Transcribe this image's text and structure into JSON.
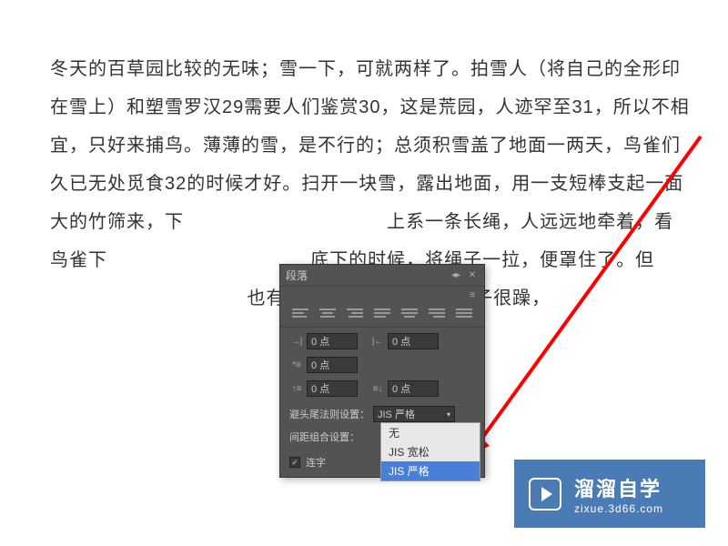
{
  "body_text": "冬天的百草园比较的无味；雪一下，可就两样了。拍雪人（将自己的全形印在雪上）和塑雪罗汉29需要人们鉴赏30，这是荒园，人迹罕至31，所以不相宜，只好来捕鸟。薄薄的雪，是不行的；总须积雪盖了地面一两天，鸟雀们久已无处觅食32的时候才好。扫开一块雪，露出地面，用一支短棒支起一面大的竹筛来，下 　　　　　　　　　　 上系一条长绳，人远远地牵着，看鸟雀下 　　　　　　　　　　 底下的时候，将绳子一拉，便罩住了。但 　　　　　　　　　　 也有白颊的“张飞鸟34”，性子很躁，",
  "panel": {
    "title": "段落",
    "indent_left": "0 点",
    "indent_right": "0 点",
    "first_line": "0 点",
    "space_before": "0 点",
    "space_after": "0 点",
    "kinsoku_label": "避头尾法则设置：",
    "kinsoku_value": "JIS 严格",
    "mojikumi_label": "间距组合设置：",
    "options": {
      "none": "无",
      "loose": "JIS 宽松",
      "strict": "JIS 严格"
    },
    "hyphenate_label": "连字"
  },
  "watermark": {
    "title": "溜溜自学",
    "sub": "zixue.3d66.com"
  }
}
